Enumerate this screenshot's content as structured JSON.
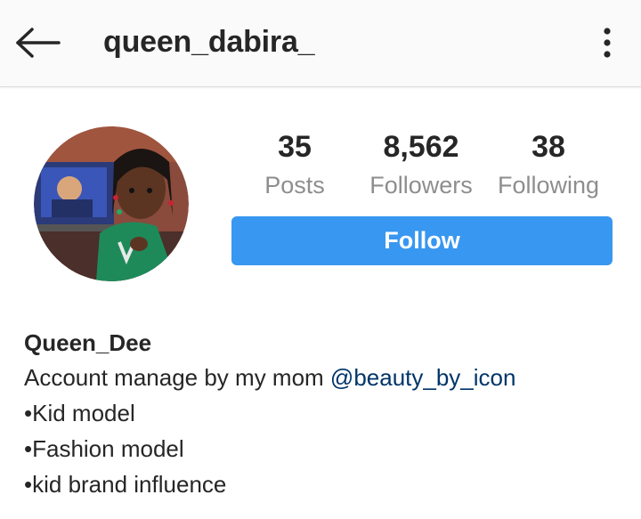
{
  "header": {
    "username": "queen_dabira_",
    "back_icon": "arrow-left-icon",
    "more_icon": "vertical-ellipsis-icon"
  },
  "profile": {
    "avatar_icon": "profile-photo",
    "stats": [
      {
        "value": "35",
        "label": "Posts"
      },
      {
        "value": "8,562",
        "label": "Followers"
      },
      {
        "value": "38",
        "label": "Following"
      }
    ],
    "follow_label": "Follow"
  },
  "bio": {
    "name": "Queen_Dee",
    "line1_text": "Account manage by my mom ",
    "line1_mention": "@beauty_by_icon",
    "line2": "•Kid model",
    "line3": "•Fashion model",
    "line4": "•kid brand influence"
  },
  "colors": {
    "follow_button": "#3897f0",
    "mention": "#003569",
    "secondary_text": "#8e8e8e",
    "primary_text": "#262626"
  }
}
